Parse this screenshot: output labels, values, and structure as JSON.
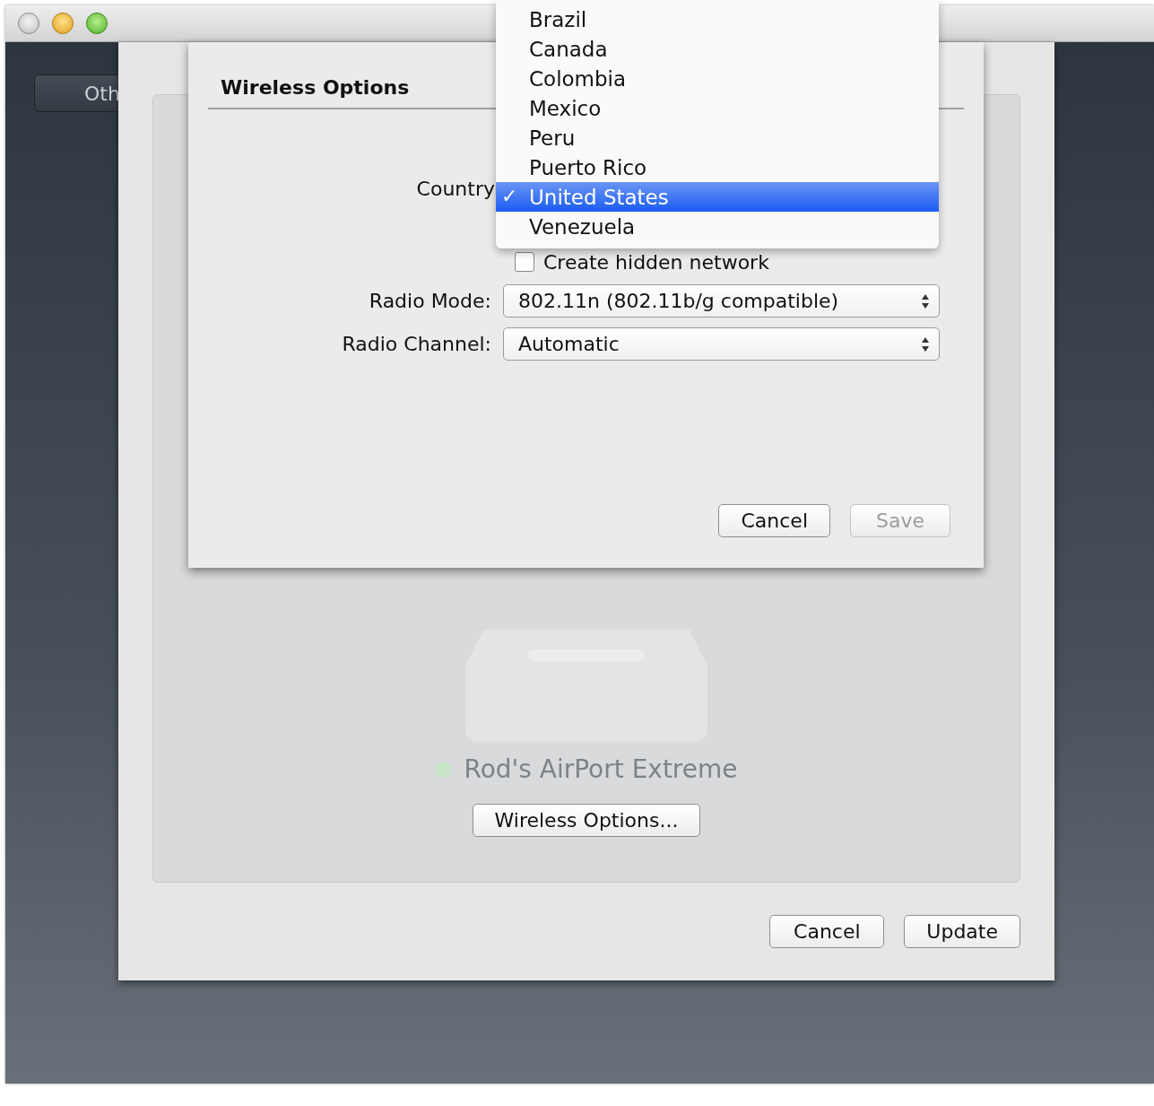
{
  "window": {
    "tab_label": "Oth"
  },
  "main_panel": {
    "device_name": "Rod's AirPort Extreme",
    "device_online": true,
    "options_button": "Wireless Options...",
    "buttons": [
      {
        "label": "Cancel",
        "disabled": false
      },
      {
        "label": "Update",
        "disabled": false
      }
    ]
  },
  "sheet": {
    "title": "Wireless Options",
    "country_label": "Country",
    "hidden_network": {
      "label": "Create hidden network",
      "checked": false
    },
    "popups": [
      {
        "label": "Radio Mode:",
        "value": "802.11n (802.11b/g compatible)"
      },
      {
        "label": "Radio Channel:",
        "value": "Automatic"
      }
    ],
    "buttons": [
      {
        "label": "Cancel",
        "disabled": false
      },
      {
        "label": "Save",
        "disabled": true
      }
    ]
  },
  "country_menu": {
    "items": [
      {
        "label": "Brazil",
        "selected": false
      },
      {
        "label": "Canada",
        "selected": false
      },
      {
        "label": "Colombia",
        "selected": false
      },
      {
        "label": "Mexico",
        "selected": false
      },
      {
        "label": "Peru",
        "selected": false
      },
      {
        "label": "Puerto Rico",
        "selected": false
      },
      {
        "label": "United States",
        "selected": true,
        "mark": "✓"
      },
      {
        "label": "Venezuela",
        "selected": false
      }
    ]
  }
}
